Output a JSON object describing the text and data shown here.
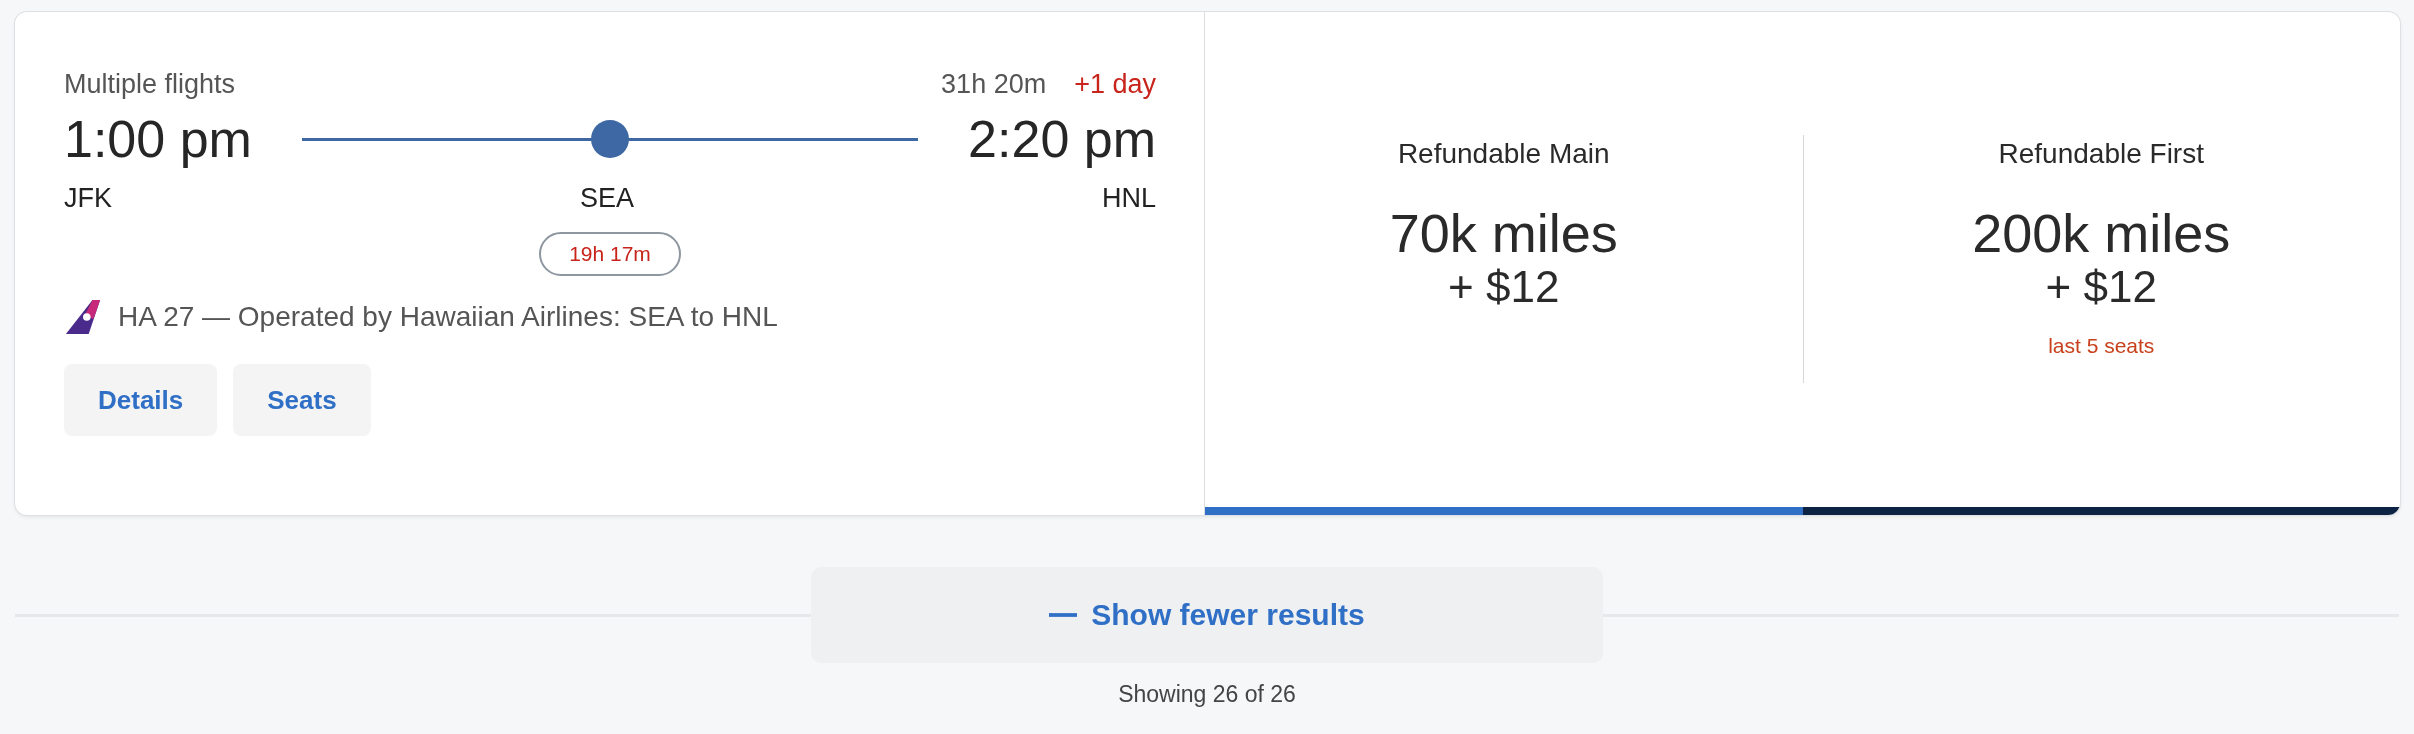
{
  "itinerary": {
    "label": "Multiple flights",
    "duration": "31h 20m",
    "day_offset": "+1 day",
    "departure": {
      "time": "1:00 pm",
      "airport": "JFK"
    },
    "stop": {
      "airport": "SEA",
      "layover": "19h 17m"
    },
    "arrival": {
      "time": "2:20 pm",
      "airport": "HNL"
    },
    "operated_by": "HA 27 — Operated by Hawaiian Airlines: SEA to HNL",
    "buttons": [
      "Details",
      "Seats"
    ]
  },
  "fares": [
    {
      "name": "Refundable Main",
      "miles": "70k miles",
      "fee": "+ $12",
      "color": "#2f6fc6"
    },
    {
      "name": "Refundable First",
      "miles": "200k miles",
      "fee": "+ $12",
      "note": "last 5 seats",
      "color": "#0d2344"
    }
  ],
  "show_fewer_button": "Show fewer results",
  "results_count": "Showing 26 of 26"
}
